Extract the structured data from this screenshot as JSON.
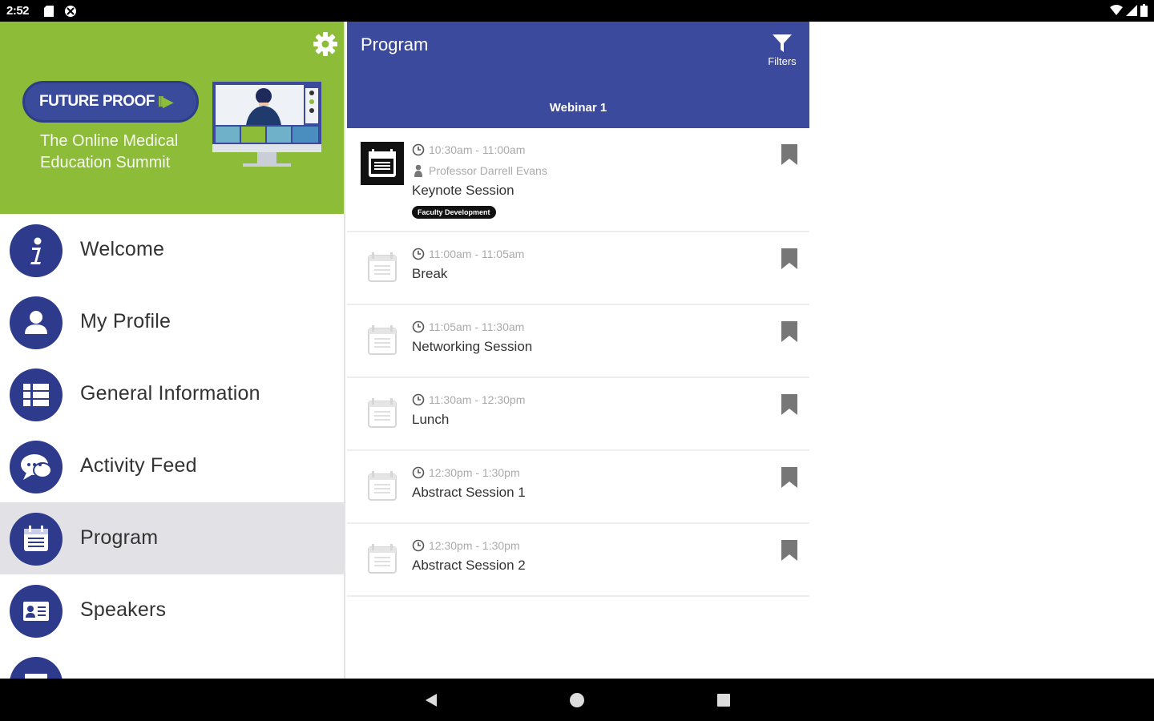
{
  "status_bar": {
    "time": "2:52"
  },
  "drawer": {
    "brand": {
      "name": "FUTURE PROOF",
      "arrows": "II▶",
      "tagline": "The Online Medical Education Summit"
    },
    "menu": [
      {
        "label": "Welcome",
        "icon": "info-icon",
        "active": false
      },
      {
        "label": "My Profile",
        "icon": "profile-icon",
        "active": false
      },
      {
        "label": "General Information",
        "icon": "list-icon",
        "active": false
      },
      {
        "label": "Activity Feed",
        "icon": "chat-icon",
        "active": false
      },
      {
        "label": "Program",
        "icon": "calendar-icon",
        "active": true
      },
      {
        "label": "Speakers",
        "icon": "id-card-icon",
        "active": false
      },
      {
        "label": "",
        "icon": "building-icon",
        "active": false
      }
    ]
  },
  "program": {
    "title": "Program",
    "filters_label": "Filters",
    "tab": "Webinar 1",
    "sessions": [
      {
        "time": "10:30am - 11:00am",
        "speaker": "Professor Darrell Evans",
        "title": "Keynote Session",
        "tag": "Faculty Development"
      },
      {
        "time": "11:00am - 11:05am",
        "title": "Break"
      },
      {
        "time": "11:05am - 11:30am",
        "title": "Networking Session"
      },
      {
        "time": "11:30am - 12:30pm",
        "title": "Lunch"
      },
      {
        "time": "12:30pm - 1:30pm",
        "title": "Abstract Session 1"
      },
      {
        "time": "12:30pm - 1:30pm",
        "title": "Abstract Session 2"
      }
    ]
  },
  "colors": {
    "header_green": "#8dbc38",
    "primary_blue": "#3b4a9c",
    "icon_blue": "#2e3a8c"
  }
}
